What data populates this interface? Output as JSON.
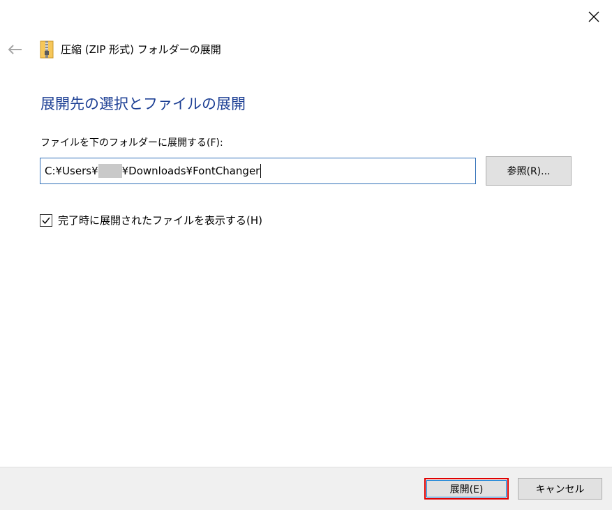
{
  "window": {
    "title": "圧縮 (ZIP 形式) フォルダーの展開",
    "close_icon": "close-icon",
    "back_icon": "back-arrow-icon",
    "folder_icon": "zip-folder-icon"
  },
  "main": {
    "heading": "展開先の選択とファイルの展開",
    "destination_label": "ファイルを下のフォルダーに展開する(F):",
    "destination_path": {
      "prefix": "C:¥Users¥",
      "masked_segment": "",
      "suffix": "¥Downloads¥FontChanger"
    },
    "browse_label": "参照(R)...",
    "show_files_checkbox": {
      "label": "完了時に展開されたファイルを表示する(H)",
      "checked": true
    }
  },
  "footer": {
    "extract_label": "展開(E)",
    "cancel_label": "キャンセル"
  },
  "colors": {
    "heading": "#1c3f94",
    "input_border": "#2f6fb8",
    "highlight": "#e00000",
    "button_bg": "#e1e1e1",
    "footer_bg": "#f0f0f0"
  }
}
